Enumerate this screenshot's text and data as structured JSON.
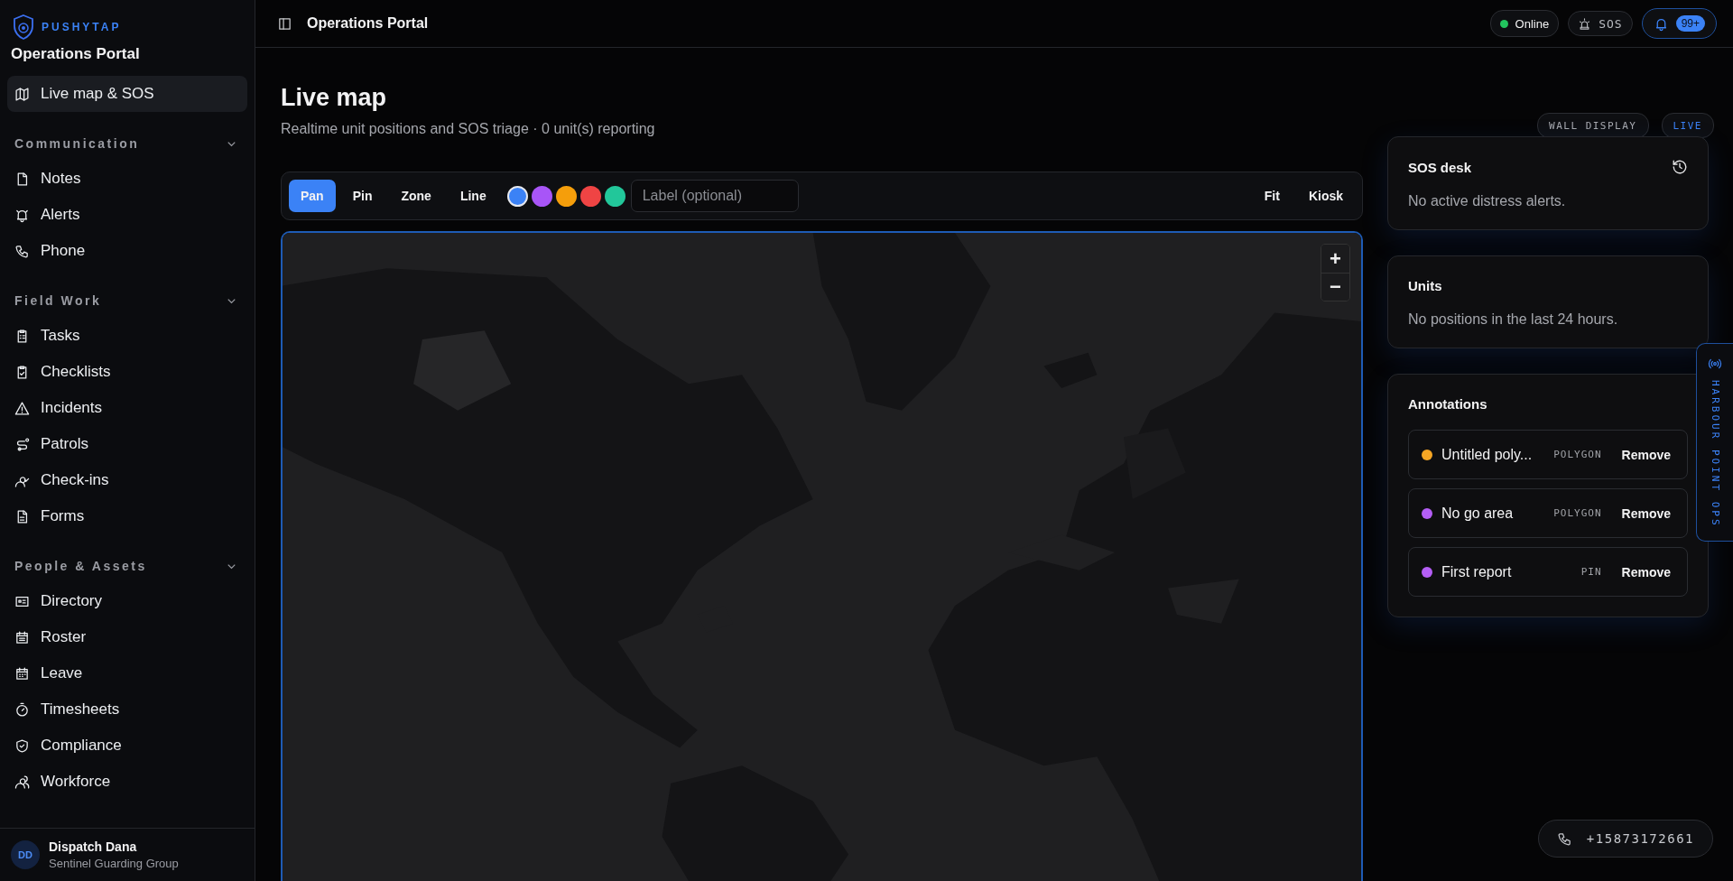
{
  "brand": {
    "name": "PUSHYTAP",
    "subtitle": "Operations Portal"
  },
  "sidebar": {
    "items": [
      {
        "label": "Live map & SOS",
        "selected": true
      }
    ],
    "sections": [
      {
        "title": "Communication",
        "expanded": true,
        "items": [
          {
            "label": "Notes",
            "selected": false
          },
          {
            "label": "Alerts",
            "selected": false
          },
          {
            "label": "Phone",
            "selected": false
          }
        ]
      },
      {
        "title": "Field Work",
        "expanded": true,
        "items": [
          {
            "label": "Tasks",
            "selected": false
          },
          {
            "label": "Checklists",
            "selected": false
          },
          {
            "label": "Incidents",
            "selected": false
          },
          {
            "label": "Patrols",
            "selected": false
          },
          {
            "label": "Check-ins",
            "selected": false
          },
          {
            "label": "Forms",
            "selected": false
          }
        ]
      },
      {
        "title": "People & Assets",
        "expanded": true,
        "items": [
          {
            "label": "Directory",
            "selected": false
          },
          {
            "label": "Roster",
            "selected": false
          },
          {
            "label": "Leave",
            "selected": false
          },
          {
            "label": "Timesheets",
            "selected": false
          },
          {
            "label": "Compliance",
            "selected": false
          },
          {
            "label": "Workforce",
            "selected": false
          }
        ]
      }
    ]
  },
  "user": {
    "initials": "DD",
    "name": "Dispatch Dana",
    "org": "Sentinel Guarding Group"
  },
  "topbar": {
    "title": "Operations Portal",
    "status": {
      "label": "Online",
      "color": "#22c55e"
    },
    "sos": "SOS",
    "notifications": "99+"
  },
  "page": {
    "title": "Live map",
    "subtitle": "Realtime unit positions and SOS triage · 0 unit(s) reporting",
    "badges": [
      {
        "label": "WALL DISPLAY",
        "kind": "plain"
      },
      {
        "label": "LIVE",
        "kind": "live"
      }
    ]
  },
  "toolbar": {
    "tools": [
      {
        "label": "Pan",
        "selected": true
      },
      {
        "label": "Pin",
        "selected": false
      },
      {
        "label": "Zone",
        "selected": false
      },
      {
        "label": "Line",
        "selected": false
      }
    ],
    "colors": [
      {
        "color": "#3b82f6",
        "selected": true
      },
      {
        "color": "#a855f7",
        "selected": false
      },
      {
        "color": "#f59e0b",
        "selected": false
      },
      {
        "color": "#ef4444",
        "selected": false
      },
      {
        "color": "#22c79a",
        "selected": false
      }
    ],
    "label_placeholder": "Label (optional)",
    "actions": [
      "Fit",
      "Kiosk"
    ]
  },
  "map": {
    "kind": "picture",
    "zoom": [
      "+",
      "−"
    ]
  },
  "sos_desk": {
    "title": "SOS desk",
    "message": "No active distress alerts."
  },
  "units": {
    "title": "Units",
    "message": "No positions in the last 24 hours."
  },
  "annotations": {
    "title": "Annotations",
    "items": [
      {
        "name": "Untitled poly...",
        "type": "POLYGON",
        "color": "#f5a524",
        "action": "Remove"
      },
      {
        "name": "No go area",
        "type": "POLYGON",
        "color": "#b45ef5",
        "action": "Remove"
      },
      {
        "name": "First report",
        "type": "PIN",
        "color": "#b45ef5",
        "action": "Remove"
      }
    ]
  },
  "side_tab": "HARBOUR POINT OPS",
  "phone": "+15873172661"
}
